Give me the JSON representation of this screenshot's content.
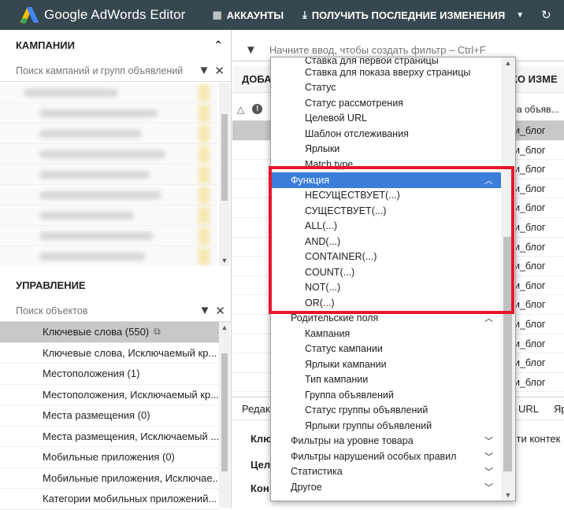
{
  "app": {
    "title": "Google AdWords Editor",
    "accounts_label": "АККАУНТЫ",
    "get_changes_label": "ПОЛУЧИТЬ ПОСЛЕДНИЕ ИЗМЕНЕНИЯ"
  },
  "campaigns": {
    "header": "КАМПАНИИ",
    "search_placeholder": "Поиск кампаний и групп объявлений"
  },
  "management": {
    "header": "УПРАВЛЕНИЕ",
    "search_placeholder": "Поиск объектов",
    "items": [
      {
        "label": "Ключевые слова (550)",
        "selected": true
      },
      {
        "label": "Ключевые слова, Исключаемый кр..."
      },
      {
        "label": "Местоположения (1)"
      },
      {
        "label": "Местоположения, Исключаемый кр..."
      },
      {
        "label": "Места размещения (0)"
      },
      {
        "label": "Места размещения, Исключаемый ..."
      },
      {
        "label": "Мобильные приложения (0)"
      },
      {
        "label": "Мобильные приложения, Исключае..."
      },
      {
        "label": "Категории мобильных приложений..."
      }
    ]
  },
  "main": {
    "filter_placeholder": "Начните ввод, чтобы создать фильтр – Ctrl+F",
    "action_left": "ДОБА",
    "action_right": "КО ИЗМЕ",
    "column_header": "ла объяв...",
    "rows": [
      "и_блог",
      "и_блог",
      "и_блог",
      "и_блог",
      "и_блог",
      "и_блог",
      "и_блог",
      "и_блог",
      "и_блог",
      "и_блог",
      "и_блог",
      "и_блог",
      "и_блог",
      "и_блог"
    ],
    "bottom_tabs": {
      "left": "Редакт",
      "url": "URL",
      "cut": "Яр"
    },
    "edit_fields": [
      "Клю",
      "Цел",
      "Кон"
    ],
    "edit_right": "сти контек"
  },
  "dropdown": {
    "top_partial": "Ставка для первой страницы",
    "items_a": [
      "Ставка для показа вверху страницы",
      "Статус",
      "Статус рассмотрения",
      "Целевой URL",
      "Шаблон отслеживания",
      "Ярлыки",
      "Match type"
    ],
    "function_group": "Функция",
    "function_items": [
      "НЕСУЩЕСТВУЕТ(...)",
      "СУЩЕСТВУЕТ(...)",
      "ALL(...)",
      "AND(...)",
      "CONTAINER(...)",
      "COUNT(...)",
      "NOT(...)",
      "OR(...)"
    ],
    "parent_group": "Родительские поля",
    "parent_items": [
      "Кампания",
      "Статус кампании",
      "Ярлыки кампании",
      "Тип кампании",
      "Группа объявлений",
      "Статус группы объявлений",
      "Ярлыки группы объявлений"
    ],
    "bottom_groups": [
      "Фильтры на уровне товара",
      "Фильтры нарушений особых правил",
      "Статистика",
      "Другое"
    ]
  },
  "colors": {
    "topbar": "#37474f",
    "selection": "#3b7dd8",
    "highlight": "#e8152b"
  }
}
